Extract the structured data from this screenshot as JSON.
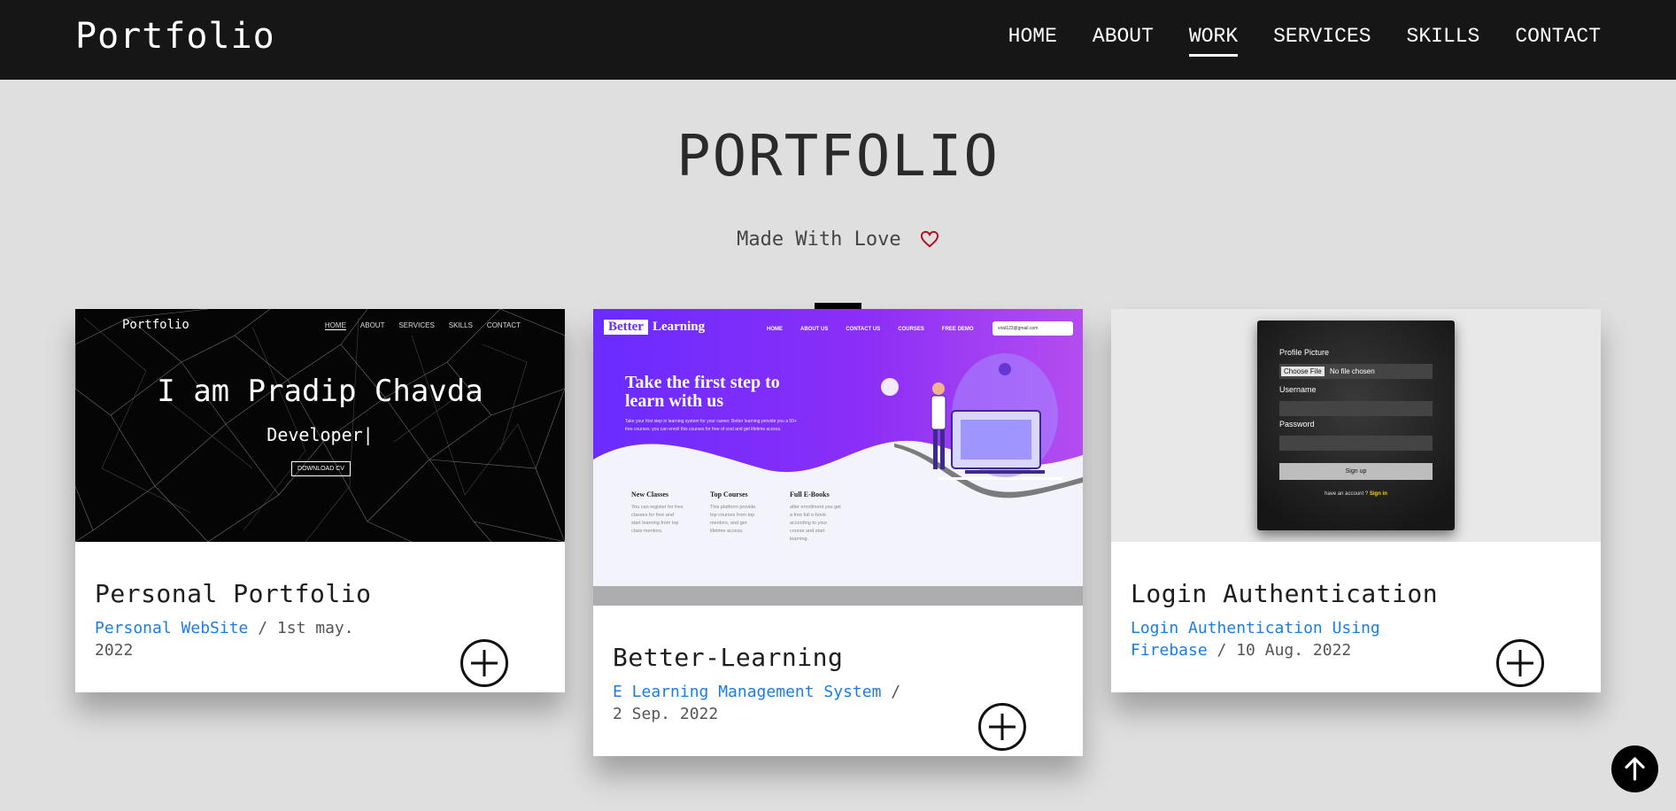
{
  "navbar": {
    "brand": "Portfolio",
    "items": [
      {
        "label": "HOME"
      },
      {
        "label": "ABOUT"
      },
      {
        "label": "WORK",
        "active": true
      },
      {
        "label": "SERVICES"
      },
      {
        "label": "SKILLS"
      },
      {
        "label": "CONTACT"
      }
    ]
  },
  "header": {
    "title": "PORTFOLIO",
    "subtitle": "Made With Love",
    "heart_icon": "heart-icon",
    "heart_color": "#b0101f"
  },
  "projects": [
    {
      "title": "Personal Portfolio",
      "category": "Personal WebSite",
      "date": "/ 1st may. 2022",
      "preview": {
        "brand": "Portfolio",
        "nav": [
          "HOME",
          "ABOUT",
          "SERVICES",
          "SKILLS",
          "CONTACT"
        ],
        "hero": "I am Pradip Chavda",
        "role": "Developer|",
        "button": "DOWNLOAD CV"
      }
    },
    {
      "title": "Better-Learning",
      "category": "E Learning Management System",
      "date": "/ 2 Sep. 2022",
      "preview": {
        "logo_a": "Better",
        "logo_b": "Learning",
        "nav": [
          "HOME",
          "ABOUT US",
          "CONTACT US",
          "COURSES",
          "FREE DEMO"
        ],
        "email": "viral123@gmail.com",
        "heading": "Take the first step to learn with us",
        "paragraph": "Take your first step in learning system for your career. Better learning provide you a 50+ free courses. you can enroll this courses for free of cost and get lifetime access.",
        "features": [
          {
            "title": "New Classes",
            "text": "You can register for free classes for free and start learning from top class mentors."
          },
          {
            "title": "Top Courses",
            "text": "This platform provide top courses from top mentors, and get lifetime access."
          },
          {
            "title": "Full E-Books",
            "text": "after enrollment you get a free full e-book according to your course and start learning."
          }
        ]
      }
    },
    {
      "title": "Login Authentication",
      "category": "Login Authentication Using Firebase",
      "date": "/ 10 Aug. 2022",
      "preview": {
        "profile_label": "Profile Picture",
        "file_button": "Choose File",
        "file_text": "No file chosen",
        "username_label": "Username",
        "password_label": "Password",
        "signup_button": "Sign up",
        "have_account": "have an account ?",
        "signin_link": "Sign in"
      }
    }
  ],
  "colors": {
    "navbar_bg": "#161616",
    "page_bg": "#dfdfdf",
    "link": "#1a7ee6",
    "purple": "#7a2df9"
  },
  "back_to_top_icon": "arrow-up-icon"
}
